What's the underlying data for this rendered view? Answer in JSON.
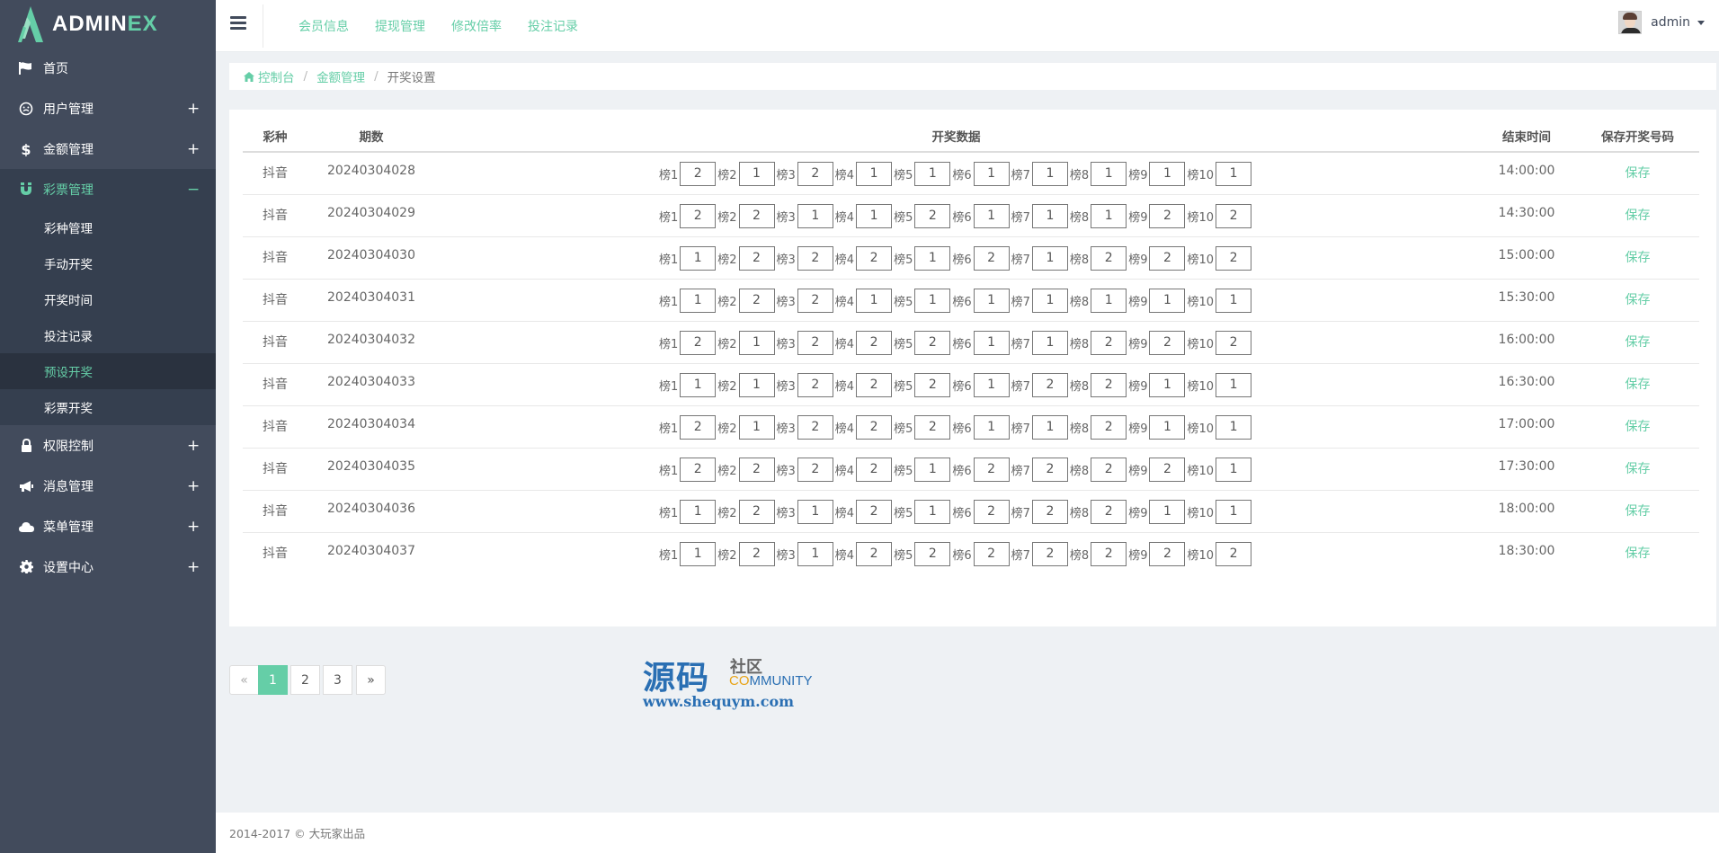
{
  "brand": {
    "text_main": "ADMIN",
    "text_accent": "EX"
  },
  "sidebar": {
    "items": [
      {
        "label": "首页",
        "icon": "flag-icon",
        "toggle": ""
      },
      {
        "label": "用户管理",
        "icon": "user-circle-icon",
        "toggle": "+"
      },
      {
        "label": "金额管理",
        "icon": "dollar-icon",
        "toggle": "+"
      },
      {
        "label": "彩票管理",
        "icon": "magnet-icon",
        "toggle": "−",
        "expanded": true,
        "sub": [
          {
            "label": "彩种管理"
          },
          {
            "label": "手动开奖"
          },
          {
            "label": "开奖时间"
          },
          {
            "label": "投注记录"
          },
          {
            "label": "预设开奖",
            "active": true
          },
          {
            "label": "彩票开奖"
          }
        ]
      },
      {
        "label": "权限控制",
        "icon": "lock-icon",
        "toggle": "+"
      },
      {
        "label": "消息管理",
        "icon": "bullhorn-icon",
        "toggle": "+"
      },
      {
        "label": "菜单管理",
        "icon": "cloud-icon",
        "toggle": "+"
      },
      {
        "label": "设置中心",
        "icon": "gear-icon",
        "toggle": "+"
      }
    ]
  },
  "header": {
    "links": [
      "会员信息",
      "提现管理",
      "修改倍率",
      "投注记录"
    ],
    "username": "admin"
  },
  "breadcrumb": {
    "home": "控制台",
    "parent": "金额管理",
    "current": "开奖设置"
  },
  "table": {
    "headers": [
      "彩种",
      "期数",
      "开奖数据",
      "结束时间",
      "保存开奖号码"
    ],
    "slot_names": [
      "榜1",
      "榜2",
      "榜3",
      "榜4",
      "榜5",
      "榜6",
      "榜7",
      "榜8",
      "榜9",
      "榜10"
    ],
    "save_label": "保存",
    "rows": [
      {
        "type": "抖音",
        "period": "20240304028",
        "values": [
          "2",
          "1",
          "2",
          "1",
          "1",
          "1",
          "1",
          "1",
          "1",
          "1"
        ],
        "end": "14:00:00"
      },
      {
        "type": "抖音",
        "period": "20240304029",
        "values": [
          "2",
          "2",
          "1",
          "1",
          "2",
          "1",
          "1",
          "1",
          "2",
          "2"
        ],
        "end": "14:30:00"
      },
      {
        "type": "抖音",
        "period": "20240304030",
        "values": [
          "1",
          "2",
          "2",
          "2",
          "1",
          "2",
          "1",
          "2",
          "2",
          "2"
        ],
        "end": "15:00:00"
      },
      {
        "type": "抖音",
        "period": "20240304031",
        "values": [
          "1",
          "2",
          "2",
          "1",
          "1",
          "1",
          "1",
          "1",
          "1",
          "1"
        ],
        "end": "15:30:00"
      },
      {
        "type": "抖音",
        "period": "20240304032",
        "values": [
          "2",
          "1",
          "2",
          "2",
          "2",
          "1",
          "1",
          "2",
          "2",
          "2"
        ],
        "end": "16:00:00"
      },
      {
        "type": "抖音",
        "period": "20240304033",
        "values": [
          "1",
          "1",
          "2",
          "2",
          "2",
          "1",
          "2",
          "2",
          "1",
          "1"
        ],
        "end": "16:30:00"
      },
      {
        "type": "抖音",
        "period": "20240304034",
        "values": [
          "2",
          "1",
          "2",
          "2",
          "2",
          "1",
          "1",
          "2",
          "1",
          "1"
        ],
        "end": "17:00:00"
      },
      {
        "type": "抖音",
        "period": "20240304035",
        "values": [
          "2",
          "2",
          "2",
          "2",
          "1",
          "2",
          "2",
          "2",
          "2",
          "1"
        ],
        "end": "17:30:00"
      },
      {
        "type": "抖音",
        "period": "20240304036",
        "values": [
          "1",
          "2",
          "1",
          "2",
          "1",
          "2",
          "2",
          "2",
          "1",
          "1"
        ],
        "end": "18:00:00"
      },
      {
        "type": "抖音",
        "period": "20240304037",
        "values": [
          "1",
          "2",
          "1",
          "2",
          "2",
          "2",
          "2",
          "2",
          "2",
          "2"
        ],
        "end": "18:30:00"
      }
    ]
  },
  "pagination": {
    "prev": "«",
    "pages": [
      "1",
      "2",
      "3"
    ],
    "next": "»",
    "active": "1"
  },
  "watermark": {
    "big": "源码",
    "small": "社区",
    "community_a": "CO",
    "community_b": "MMUNITY",
    "url": "www.shequym.com"
  },
  "footer": {
    "text": "2014-2017 © 大玩家出品"
  },
  "colors": {
    "accent": "#65cea7",
    "sidebar_bg": "#424b5c",
    "sidebar_active_bg": "#353f4f"
  }
}
